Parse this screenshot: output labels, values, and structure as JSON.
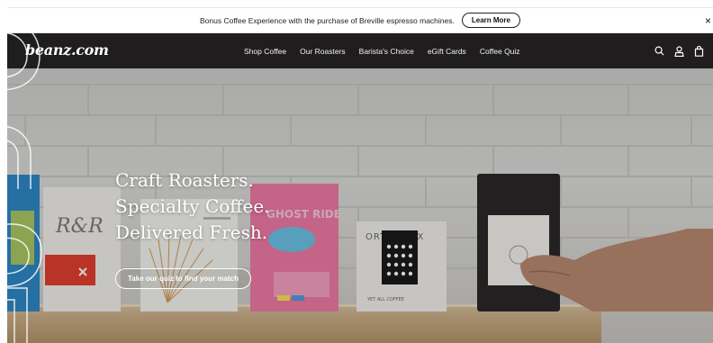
{
  "announcement": {
    "text": "Bonus Coffee Experience with the purchase of Breville espresso machines.",
    "button_label": "Learn More",
    "close_glyph": "×"
  },
  "nav": {
    "logo": "beanz.com",
    "items": [
      {
        "label": "Shop Coffee"
      },
      {
        "label": "Our Roasters"
      },
      {
        "label": "Barista's Choice"
      },
      {
        "label": "eGift Cards"
      },
      {
        "label": "Coffee Quiz"
      }
    ],
    "icons": [
      "search-icon",
      "account-icon",
      "cart-icon"
    ]
  },
  "hero": {
    "headline": [
      "Craft Roasters.",
      "Specialty Coffee.",
      "Delivered Fresh."
    ],
    "cta_label": "Take our quiz to find your match"
  },
  "product_bags": {
    "rr": {
      "logo": "R&R"
    },
    "ghost_rider": {
      "label": "GHOST RIDER"
    },
    "orthodox": {
      "label": "ORTHODOX",
      "sublabel": "YET ALL COFFEE"
    }
  },
  "colors": {
    "nav_bg": "#1f1d1e",
    "announce_bg": "#ffffff",
    "hero_text": "#ffffff"
  }
}
